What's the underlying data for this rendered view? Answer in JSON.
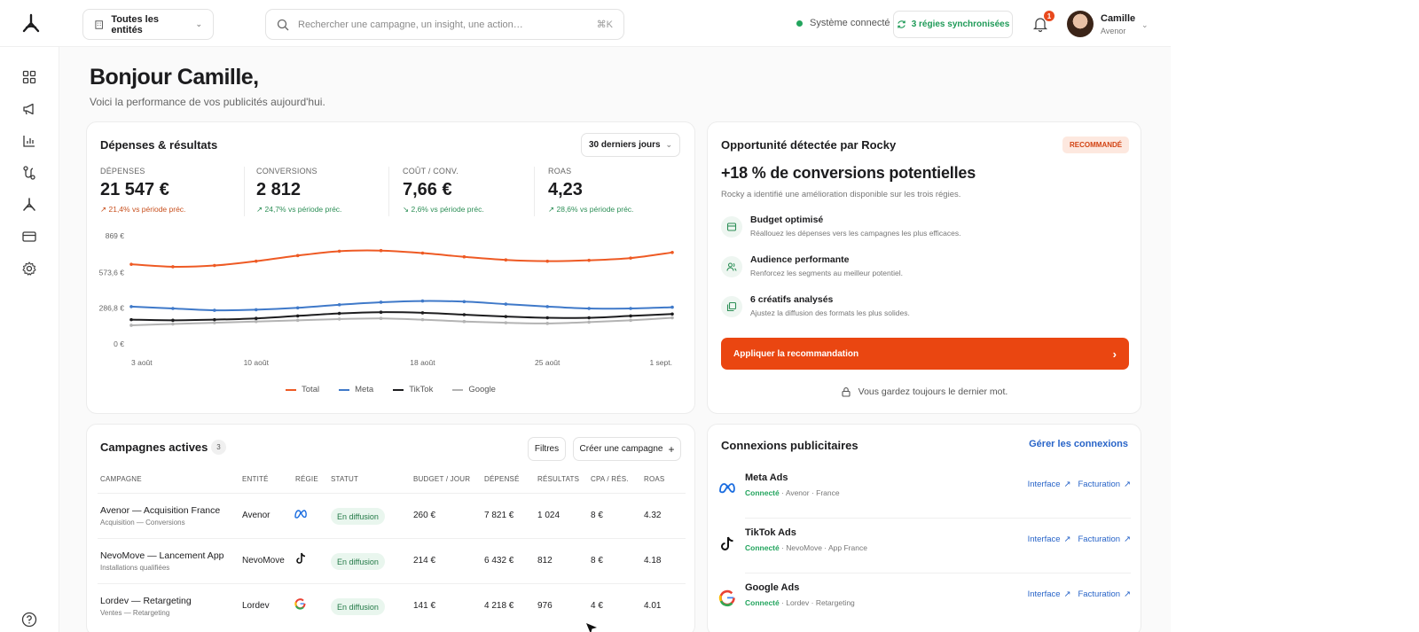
{
  "topbar": {
    "entity_selector": "Toutes les entités",
    "search_placeholder": "Rechercher une campagne, un insight, une action…",
    "search_shortcut": "⌘K",
    "system_status": "Système connecté",
    "sync_status": "3 régies synchronisées",
    "notification_count": "1",
    "user": {
      "name": "Camille",
      "org": "Avenor"
    }
  },
  "sidebar": {
    "items": [
      {
        "icon": "grid-icon"
      },
      {
        "icon": "megaphone-icon"
      },
      {
        "icon": "bar-chart-icon"
      },
      {
        "icon": "route-icon"
      },
      {
        "icon": "rocky-logo-icon"
      },
      {
        "icon": "credit-card-icon"
      },
      {
        "icon": "gear-icon"
      }
    ],
    "help_icon": "help-icon"
  },
  "greeting": {
    "title": "Bonjour Camille,",
    "subtitle": "Voici la performance de vos publicités aujourd'hui."
  },
  "performance": {
    "title": "Dépenses & résultats",
    "period": "30 derniers jours",
    "kpis": [
      {
        "label": "DÉPENSES",
        "value": "21 547 €",
        "delta": "↗ 21,4% vs période préc.",
        "trend": "up"
      },
      {
        "label": "CONVERSIONS",
        "value": "2 812",
        "delta": "↗ 24,7% vs période préc.",
        "trend": "good"
      },
      {
        "label": "COÛT / CONV.",
        "value": "7,66 €",
        "delta": "↘ 2,6% vs période préc.",
        "trend": "good"
      },
      {
        "label": "ROAS",
        "value": "4,23",
        "delta": "↗ 28,6% vs période préc.",
        "trend": "good"
      }
    ]
  },
  "chart_data": {
    "type": "line",
    "x": [
      "3 août",
      "5 août",
      "7 août",
      "10 août",
      "12 août",
      "14 août",
      "16 août",
      "18 août",
      "20 août",
      "22 août",
      "25 août",
      "27 août",
      "29 août",
      "1 sept."
    ],
    "x_tick_labels": [
      "3 août",
      "10 août",
      "18 août",
      "25 août",
      "1 sept."
    ],
    "y_tick_labels": [
      "869 €",
      "573,6 €",
      "286,8 €",
      "0 €"
    ],
    "ylim": [
      0,
      869
    ],
    "series": [
      {
        "name": "Total",
        "color": "#ee5a24",
        "values": [
          640,
          620,
          630,
          665,
          710,
          745,
          750,
          730,
          700,
          675,
          665,
          672,
          690,
          735
        ]
      },
      {
        "name": "Meta",
        "color": "#3f79c9",
        "values": [
          300,
          285,
          270,
          275,
          290,
          315,
          335,
          345,
          340,
          320,
          300,
          285,
          285,
          295
        ]
      },
      {
        "name": "TikTok",
        "color": "#1d1d1f",
        "values": [
          195,
          190,
          195,
          205,
          225,
          245,
          255,
          250,
          235,
          220,
          210,
          210,
          225,
          240
        ]
      },
      {
        "name": "Google",
        "color": "#b3b3b3",
        "values": [
          150,
          160,
          170,
          180,
          190,
          200,
          205,
          195,
          180,
          170,
          165,
          175,
          190,
          210
        ]
      }
    ],
    "legend": "bottom",
    "grid": false
  },
  "opportunity": {
    "title": "Opportunité détectée par Rocky",
    "badge": "RECOMMANDÉ",
    "headline": "+18 % de conversions potentielles",
    "description": "Rocky a identifié une amélioration disponible sur les trois régies.",
    "features": [
      {
        "icon": "budget-icon",
        "title": "Budget optimisé",
        "desc": "Réallouez les dépenses vers les campagnes les plus efficaces."
      },
      {
        "icon": "audience-icon",
        "title": "Audience performante",
        "desc": "Renforcez les segments au meilleur potentiel."
      },
      {
        "icon": "creatives-icon",
        "title": "6 créatifs analysés",
        "desc": "Ajustez la diffusion des formats les plus solides."
      }
    ],
    "apply_label": "Appliquer la recommandation",
    "footnote": "Vous gardez toujours le dernier mot."
  },
  "campaigns": {
    "title": "Campagnes actives",
    "count": "3",
    "filters_label": "Filtres",
    "create_label": "Créer une campagne",
    "columns": [
      "CAMPAGNE",
      "ENTITÉ",
      "RÉGIE",
      "STATUT",
      "BUDGET / JOUR",
      "DÉPENSÉ",
      "RÉSULTATS",
      "CPA / RÉS.",
      "ROAS"
    ],
    "rows": [
      {
        "name": "Avenor — Acquisition France",
        "sub": "Acquisition — Conversions",
        "entity": "Avenor",
        "platform": "meta",
        "status": "En diffusion",
        "budget": "260 €",
        "spent": "7 821 €",
        "results": "1 024",
        "cpa": "8 €",
        "roas": "4.32"
      },
      {
        "name": "NevoMove — Lancement App",
        "sub": "Installations qualifiées",
        "entity": "NevoMove",
        "platform": "tiktok",
        "status": "En diffusion",
        "budget": "214 €",
        "spent": "6 432 €",
        "results": "812",
        "cpa": "8 €",
        "roas": "4.18"
      },
      {
        "name": "Lordev — Retargeting",
        "sub": "Ventes — Retargeting",
        "entity": "Lordev",
        "platform": "google",
        "status": "En diffusion",
        "budget": "141 €",
        "spent": "4 218 €",
        "results": "976",
        "cpa": "4 €",
        "roas": "4.01"
      }
    ]
  },
  "connections": {
    "title": "Connexions publicitaires",
    "manage_label": "Gérer les connexions",
    "items": [
      {
        "name": "Meta Ads",
        "status": "Connecté",
        "detail": " · Avenor · France",
        "interface": "Interface",
        "billing": "Facturation"
      },
      {
        "name": "TikTok Ads",
        "status": "Connecté",
        "detail": " · NevoMove · App France",
        "interface": "Interface",
        "billing": "Facturation"
      },
      {
        "name": "Google Ads",
        "status": "Connecté",
        "detail": " · Lordev · Retargeting",
        "interface": "Interface",
        "billing": "Facturation"
      }
    ]
  }
}
